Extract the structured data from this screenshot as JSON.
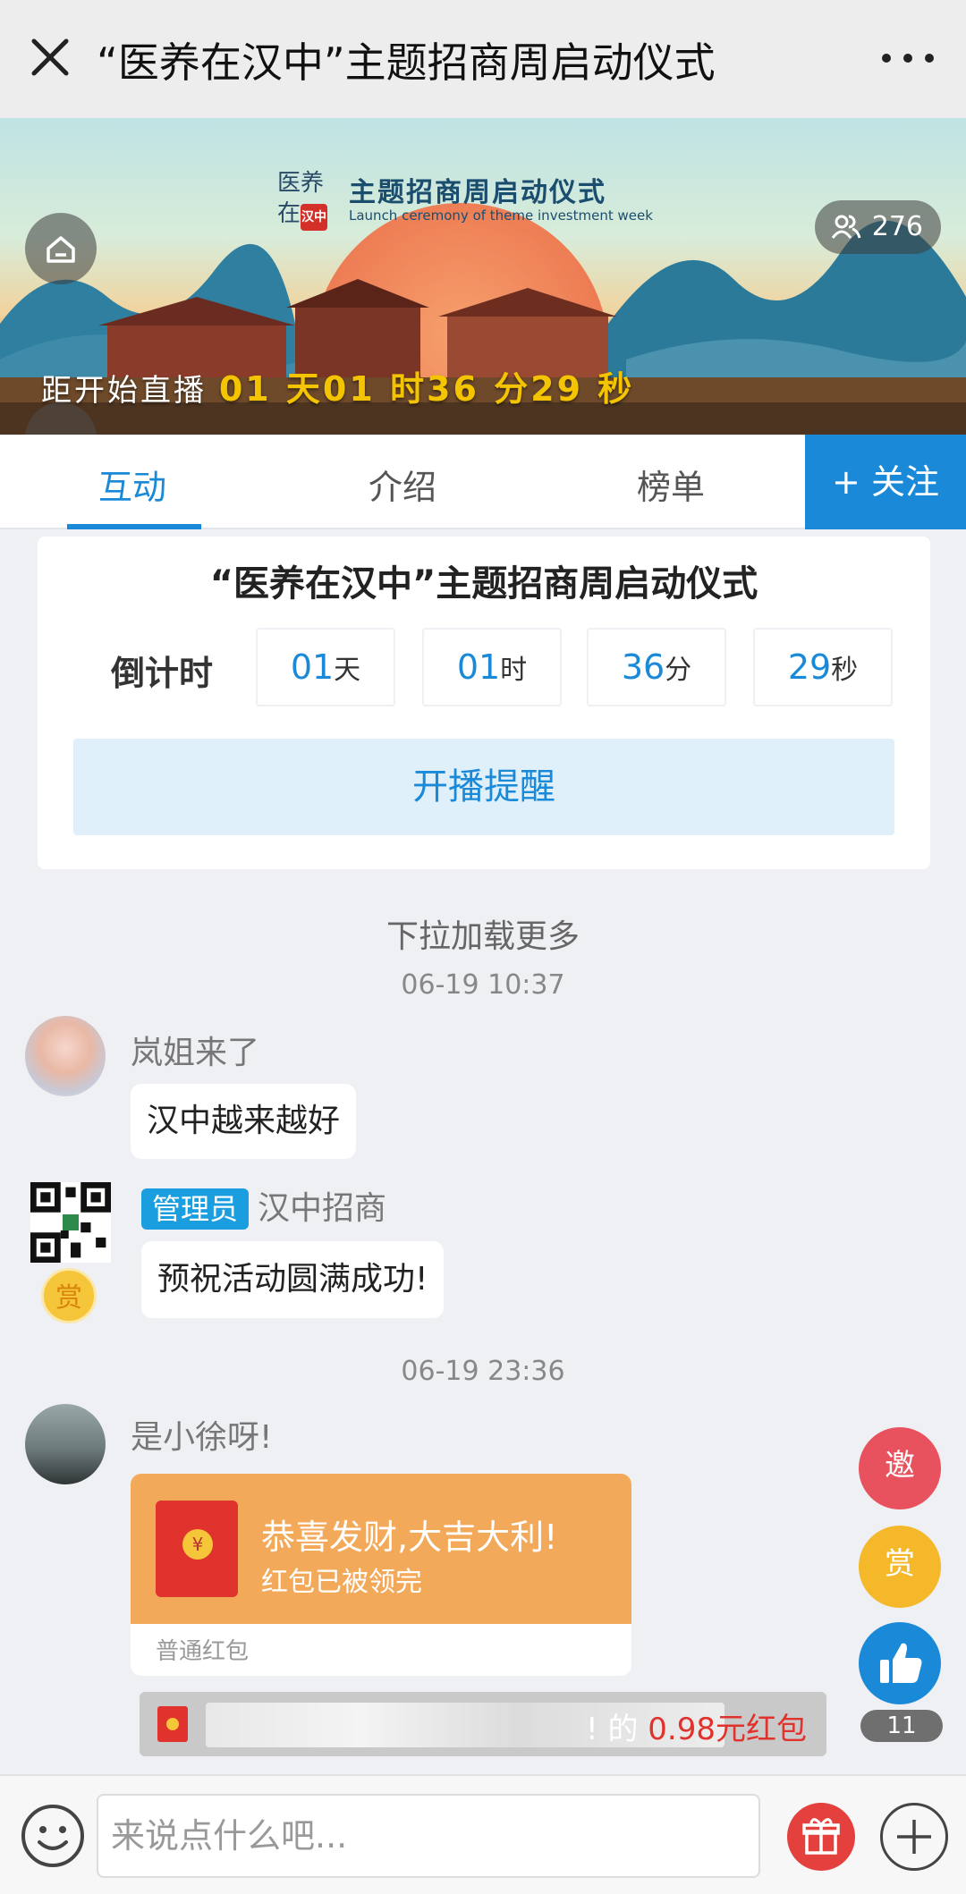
{
  "nav": {
    "title": "“医养在汉中”主题招商周启动仪式"
  },
  "banner": {
    "title_cn": "主题招商周启动仪式",
    "title_en": "Launch ceremony of theme investment week",
    "viewer_count": "276",
    "countdown_prefix": "距开始直播",
    "countdown_text": "01 天01 时36 分29 秒"
  },
  "tabs": {
    "interact": "互动",
    "intro": "介绍",
    "ranking": "榜单",
    "follow": "+ 关注"
  },
  "card": {
    "title": "“医养在汉中”主题招商周启动仪式",
    "countdown_label": "倒计时",
    "days": "01",
    "days_unit": "天",
    "hours": "01",
    "hours_unit": "时",
    "minutes": "36",
    "minutes_unit": "分",
    "seconds": "29",
    "seconds_unit": "秒",
    "remind_button": "开播提醒"
  },
  "chat": {
    "load_more": "下拉加载更多",
    "stamp1": "06-19 10:37",
    "stamp2": "06-19 23:36",
    "messages": [
      {
        "user": "岚姐来了",
        "text": "汉中越来越好"
      },
      {
        "badge": "管理员",
        "user": "汉中招商",
        "text": "预祝活动圆满成功!",
        "reward_badge": "赏"
      },
      {
        "user": "是小徐呀!"
      }
    ],
    "red_packet": {
      "greeting": "恭喜发财,大吉大利!",
      "status": "红包已被领完",
      "type": "普通红包"
    },
    "notice": {
      "suffix": "! 的 ",
      "amount": "0.98元红包"
    }
  },
  "side": {
    "invite": "邀",
    "reward": "赏",
    "like_count": "11"
  },
  "input": {
    "placeholder": "来说点什么吧..."
  },
  "colors": {
    "accent": "#1a8ad8",
    "red": "#e0332d",
    "gold": "#f5c400"
  }
}
